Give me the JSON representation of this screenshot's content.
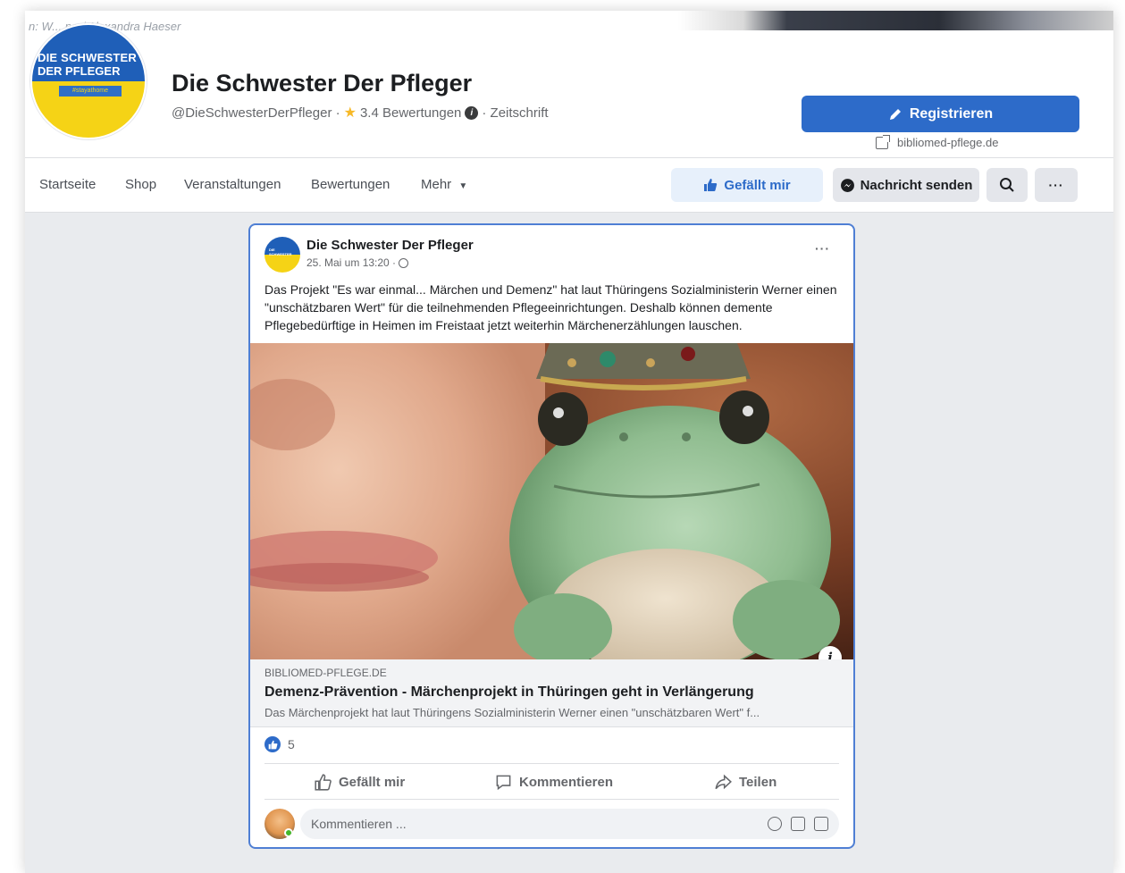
{
  "cover": {
    "crumb": "n: W... ner/ Alexandra Haeser"
  },
  "page": {
    "logo_line1": "DIE SCHWESTER",
    "logo_line2": "DER PFLEGER",
    "logo_tag": "#stayathome",
    "name": "Die Schwester Der Pfleger",
    "handle": "@DieSchwesterDerPfleger ·",
    "rating": "3.4 Bewertungen",
    "category": "· Zeitschrift",
    "register_label": "Registrieren",
    "website": "bibliomed-pflege.de"
  },
  "nav": {
    "items": [
      "Startseite",
      "Shop",
      "Veranstaltungen",
      "Bewertungen",
      "Mehr"
    ],
    "like_label": "Gefällt mir",
    "message_label": "Nachricht senden",
    "more_label": "···"
  },
  "post": {
    "author": "Die Schwester Der Pfleger",
    "date": "25. Mai um 13:20 ·",
    "menu": "···",
    "text": "Das Projekt \"Es war einmal... Märchen und Demenz\" hat laut Thüringens Sozialministerin Werner einen \"unschätzbaren Wert\" für die teilnehmenden Pflegeeinrichtungen. Deshalb können demente Pflegebedürftige in Heimen im Freistaat jetzt weiterhin Märchenerzählungen lauschen.",
    "image_info": "i",
    "link": {
      "domain": "BIBLIOMED-PFLEGE.DE",
      "title": "Demenz-Prävention - Märchenprojekt in Thüringen geht in Verlängerung",
      "desc": "Das Märchenprojekt hat laut Thüringens Sozialministerin Werner einen \"unschätzbaren Wert\" f..."
    },
    "reaction_count": "5",
    "actions": {
      "like": "Gefällt mir",
      "comment": "Kommentieren",
      "share": "Teilen"
    },
    "comment_placeholder": "Kommentieren ..."
  },
  "colors": {
    "brand_blue": "#2d6bc9",
    "logo_yellow": "#f5d316",
    "post_border": "#4f7fd4"
  }
}
